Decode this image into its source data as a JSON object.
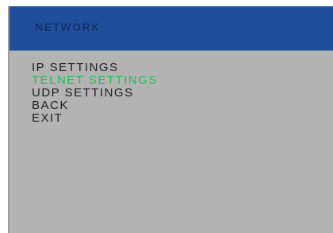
{
  "header": {
    "title": "NETWORK"
  },
  "menu": {
    "items": [
      {
        "label": "IP SETTINGS",
        "selected": false
      },
      {
        "label": "TELNET SETTINGS",
        "selected": true
      },
      {
        "label": "UDP SETTINGS",
        "selected": false
      },
      {
        "label": "BACK",
        "selected": false
      },
      {
        "label": "EXIT",
        "selected": false
      }
    ]
  },
  "colors": {
    "header_bg": "#1f4e9c",
    "header_text": "#0e2f63",
    "panel_bg": "#b3b3b3",
    "menu_text": "#1e1e1e",
    "selected_text": "#1fbf5a"
  }
}
